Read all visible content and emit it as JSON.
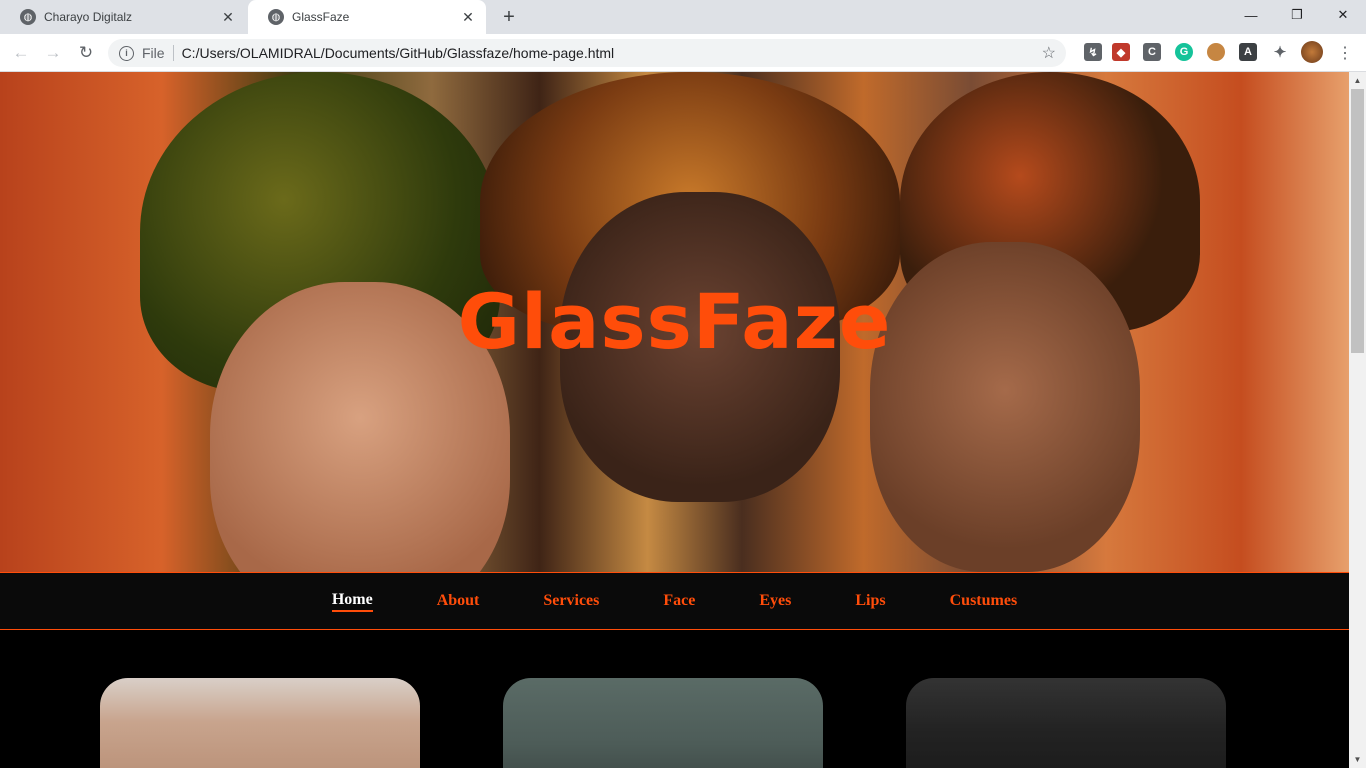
{
  "browser": {
    "tabs": [
      {
        "title": "Charayo Digitalz",
        "active": false
      },
      {
        "title": "GlassFaze",
        "active": true
      }
    ],
    "address": {
      "scheme_label": "File",
      "url": "C:/Users/OLAMIDRAL/Documents/GitHub/Glassfaze/home-page.html"
    },
    "extensions": [
      {
        "name": "extension-1-icon",
        "color": "#5f6368",
        "glyph": "↯"
      },
      {
        "name": "extension-2-icon",
        "color": "#c0392b",
        "glyph": "◆"
      },
      {
        "name": "extension-c-icon",
        "color": "#5f6368",
        "glyph": "C"
      },
      {
        "name": "grammarly-icon",
        "color": "#15c39a",
        "glyph": "G"
      },
      {
        "name": "cookie-icon",
        "color": "#c68642",
        "glyph": "●"
      },
      {
        "name": "extension-a-icon",
        "color": "#3c4043",
        "glyph": "A"
      },
      {
        "name": "extensions-puzzle-icon",
        "color": "#5f6368",
        "glyph": "✦"
      }
    ]
  },
  "page": {
    "hero_title": "GlassFaze",
    "accent_color": "#ff4d0a",
    "nav": [
      {
        "label": "Home",
        "active": true
      },
      {
        "label": "About",
        "active": false
      },
      {
        "label": "Services",
        "active": false
      },
      {
        "label": "Face",
        "active": false
      },
      {
        "label": "Eyes",
        "active": false
      },
      {
        "label": "Lips",
        "active": false
      },
      {
        "label": "Custumes",
        "active": false
      }
    ]
  }
}
